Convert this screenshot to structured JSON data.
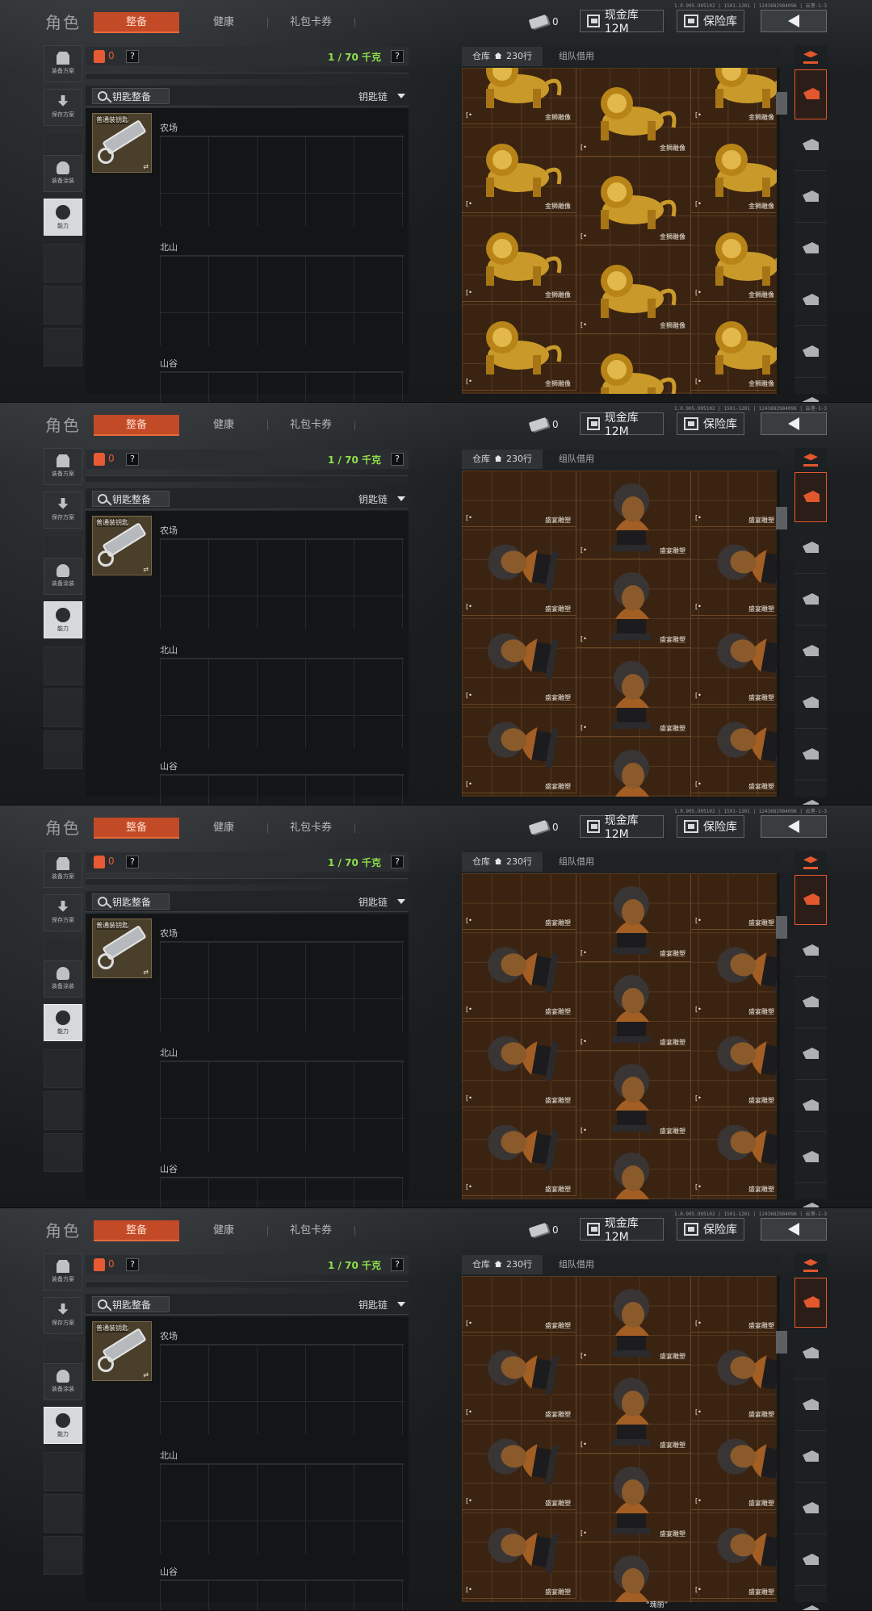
{
  "frames": [
    {
      "grid_variant": "lion",
      "build_info": "1.0.905.905102 | 1501-1201 | 1243682984096 | 云港-1-3",
      "scroll_fraction": 0.08,
      "footer_text": ""
    },
    {
      "grid_variant": "bust",
      "build_info": "1.0.905.905102 | 1501-1201 | 1243682984096 | 云港-1-3",
      "scroll_fraction": 0.12,
      "footer_text": ""
    },
    {
      "grid_variant": "bust",
      "build_info": "1.0.905.905102 | 1501-1201 | 1243682984096 | 云港-1-3",
      "scroll_fraction": 0.14,
      "footer_text": ""
    },
    {
      "grid_variant": "bust",
      "build_info": "1.0.905.905102 | 1501-1201 | 1243682984096 | 云港-1-3",
      "scroll_fraction": 0.18,
      "footer_text": "“瑰丽”"
    }
  ],
  "header": {
    "title": "角色",
    "tabs": [
      "整备",
      "健康",
      "礼包卡券"
    ],
    "active_tab": 0,
    "ticket_count": "0",
    "cash_label": "现金库 12M",
    "vault_label": "保险库"
  },
  "rail": {
    "items": [
      {
        "label": "装备方案",
        "icon": "backpack-icon"
      },
      {
        "label": "保存方案",
        "icon": "download-icon"
      },
      {
        "label": "装备涂装",
        "icon": "helmet-icon"
      },
      {
        "label": "能力",
        "icon": "ability-icon"
      }
    ]
  },
  "loadout": {
    "bag_count": "0",
    "help": "?",
    "weight": "1 / 70 千克",
    "key_chip": "钥匙整备",
    "key_chain": "钥匙链",
    "key_item_label": "普通装钥匙",
    "key_swap": "⇄",
    "areas": [
      "农场",
      "北山",
      "山谷"
    ]
  },
  "inventory": {
    "tab_storage": "仓库",
    "tab_storage_count": "230行",
    "tab_team": "组队借用",
    "lion_name": "金狮雕像",
    "bust_name": "盛宴雕塑",
    "item_mark": "[•"
  },
  "categories": [
    "all-items-icon",
    "armor-icon",
    "helmet-icon",
    "rifle-icon",
    "magazine-icon",
    "attachment-icon",
    "gear-icon"
  ],
  "colors": {
    "accent": "#c24a26",
    "weight_green": "#8fe04b",
    "grid_bg": "#3a2311",
    "gold": "#c99a2a",
    "bronze": "#a35e24"
  }
}
